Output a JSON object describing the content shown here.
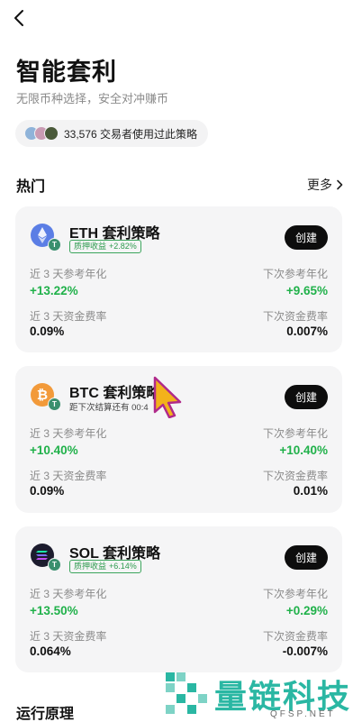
{
  "header": {
    "back_icon": "chevron-left-icon"
  },
  "page": {
    "title": "智能套利",
    "subtitle": "无限币种选择，安全对冲赚币",
    "users_text": "33,576 交易者使用过此策略"
  },
  "hot": {
    "title": "热门",
    "more_label": "更多"
  },
  "cards": [
    {
      "name": "ETH 套利策略",
      "tag_label": "质押收益",
      "tag_value": "+2.82%",
      "create_label": "创建",
      "left_label_1": "近 3 天参考年化",
      "left_value_1": "+13.22%",
      "right_label_1": "下次参考年化",
      "right_value_1": "+9.65%",
      "left_label_2": "近 3 天资金费率",
      "left_value_2": "0.09%",
      "right_label_2": "下次资金费率",
      "right_value_2": "0.007%",
      "coin_color": "#5b7ee5"
    },
    {
      "name": "BTC 套利策略",
      "note": "距下次结算还有 00:4",
      "create_label": "创建",
      "left_label_1": "近 3 天参考年化",
      "left_value_1": "+10.40%",
      "right_label_1": "下次参考年化",
      "right_value_1": "+10.40%",
      "left_label_2": "近 3 天资金费率",
      "left_value_2": "0.09%",
      "right_label_2": "下次资金费率",
      "right_value_2": "0.01%",
      "coin_color": "#f29a3a"
    },
    {
      "name": "SOL 套利策略",
      "tag_label": "质押收益",
      "tag_value": "+6.14%",
      "create_label": "创建",
      "left_label_1": "近 3 天参考年化",
      "left_value_1": "+13.50%",
      "right_label_1": "下次参考年化",
      "right_value_1": "+0.29%",
      "left_label_2": "近 3 天资金费率",
      "left_value_2": "0.064%",
      "right_label_2": "下次资金费率",
      "right_value_2": "-0.007%",
      "coin_color": "#1c1c2e"
    }
  ],
  "bottom": {
    "title": "运行原理"
  },
  "watermark": {
    "text": "量链科技",
    "sub": "QFSP.NET"
  },
  "colors": {
    "positive": "#20b14a",
    "button": "#0d0d0d",
    "card_bg": "#f5f5f6"
  }
}
